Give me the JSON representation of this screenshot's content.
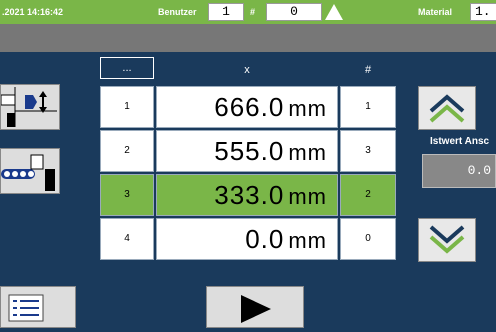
{
  "topbar": {
    "datetime": ".2021 14:16:42",
    "user_label": "Benutzer",
    "user_value": "1",
    "hash_label": "#",
    "hash_value": "0",
    "material_label": "Material",
    "material_value": "1."
  },
  "table": {
    "header_dots": "...",
    "header_x": "x",
    "header_hash": "#",
    "rows": [
      {
        "label": "1",
        "value": "666.0",
        "unit": "mm",
        "count": "1"
      },
      {
        "label": "2",
        "value": "555.0",
        "unit": "mm",
        "count": "3"
      },
      {
        "label": "3",
        "value": "333.0",
        "unit": "mm",
        "count": "2"
      },
      {
        "label": "4",
        "value": "0.0",
        "unit": "mm",
        "count": "0"
      }
    ]
  },
  "right_panel": {
    "istwert_label": "Istwert Ansc",
    "istwert_value": "0.0"
  },
  "colors": {
    "accent": "#7ab648",
    "background": "#1a3a5c",
    "bar": "#777777"
  }
}
